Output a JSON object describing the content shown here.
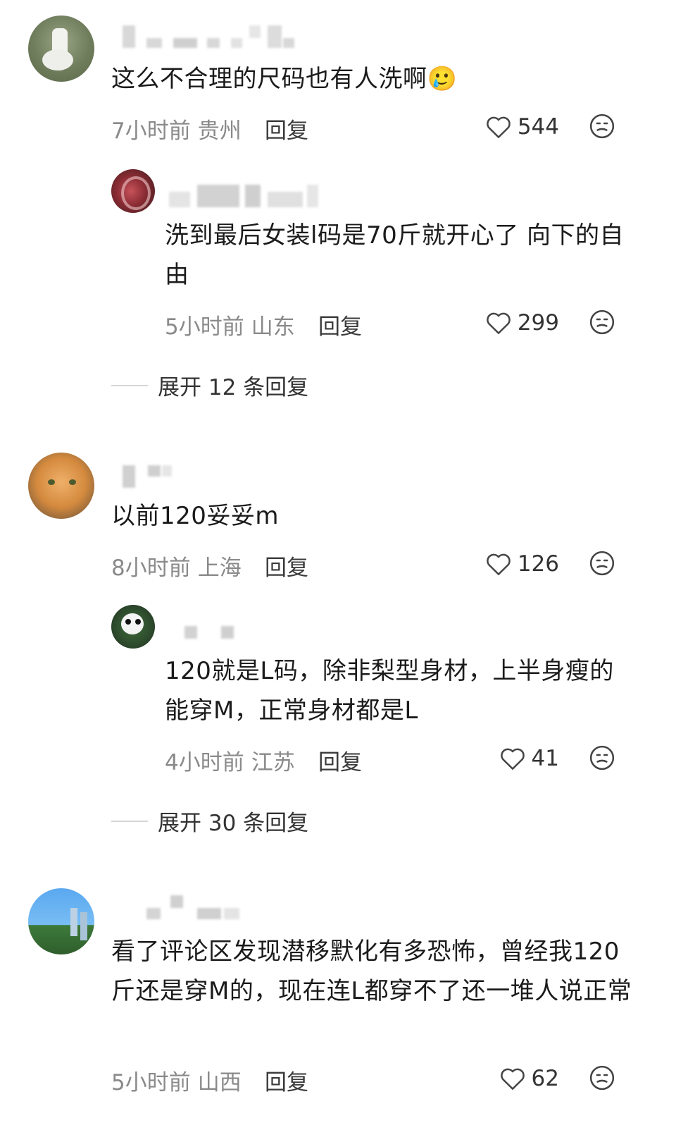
{
  "comments": [
    {
      "text": "这么不合理的尺码也有人洗啊",
      "emoji": "🥲",
      "time": "7小时前",
      "location": "贵州",
      "reply_label": "回复",
      "likes": "544",
      "replies": [
        {
          "text": "洗到最后女装l码是70斤就开心了 向下的自由",
          "time": "5小时前",
          "location": "山东",
          "reply_label": "回复",
          "likes": "299"
        }
      ],
      "expand_label": "展开 12 条回复"
    },
    {
      "text": "以前120妥妥m",
      "time": "8小时前",
      "location": "上海",
      "reply_label": "回复",
      "likes": "126",
      "replies": [
        {
          "text": "120就是L码，除非梨型身材，上半身瘦的能穿M，正常身材都是L",
          "time": "4小时前",
          "location": "江苏",
          "reply_label": "回复",
          "likes": "41"
        }
      ],
      "expand_label": "展开 30 条回复"
    },
    {
      "text": "看了评论区发现潜移默化有多恐怖，曾经我120斤还是穿M的，现在连L都穿不了还一堆人说正常",
      "time": "5小时前",
      "location": "山西",
      "reply_label": "回复",
      "likes": "62"
    }
  ],
  "icons": {
    "like": "heart-outline-icon",
    "dislike": "dislike-face-icon"
  },
  "colors": {
    "meta_text": "#8a8a8a",
    "body_text": "#1b1b1b"
  }
}
